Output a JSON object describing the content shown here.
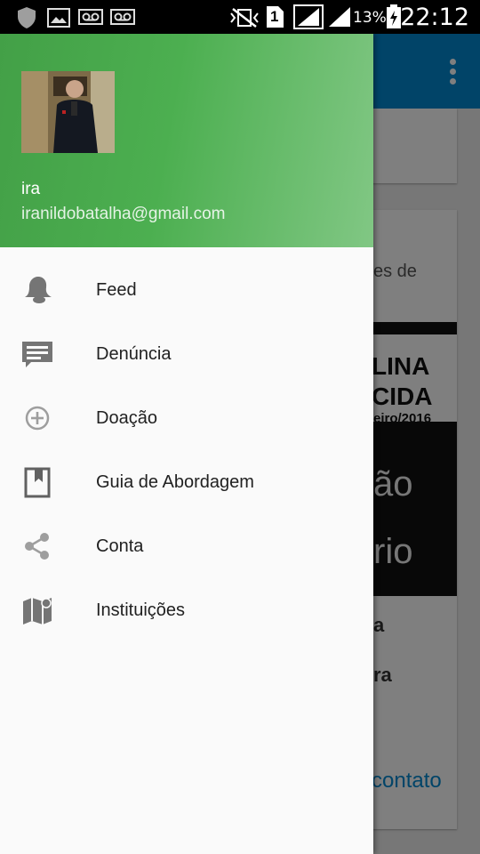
{
  "status_bar": {
    "battery_percent": "13%",
    "time": "22:12",
    "sim_slot": "1",
    "icons": [
      "shield-icon",
      "image-icon",
      "voicemail-icon",
      "voicemail-icon",
      "no-vibrate-icon",
      "sim-icon",
      "signal-icon",
      "signal-icon",
      "battery-icon"
    ]
  },
  "drawer": {
    "user": {
      "name": "ira",
      "email": "iranildobatalha@gmail.com"
    },
    "header_gradient": [
      "#43a047",
      "#81c784"
    ],
    "items": [
      {
        "label": "Feed",
        "icon": "bell-icon"
      },
      {
        "label": "Denúncia",
        "icon": "message-icon"
      },
      {
        "label": "Doação",
        "icon": "add-circle-icon"
      },
      {
        "label": "Guia de Abordagem",
        "icon": "book-icon"
      },
      {
        "label": "Conta",
        "icon": "share-icon"
      },
      {
        "label": "Instituições",
        "icon": "map-icon"
      }
    ]
  },
  "background": {
    "toolbar_color": "#0288d1",
    "card_text": "es de",
    "banner_line1": "LINA",
    "banner_line2": "CIDA",
    "banner_date": "eiro/2016",
    "image_word1": "ão",
    "image_word2": "rio",
    "line_a": "a",
    "line_b": "ra",
    "link_text": "contato"
  }
}
